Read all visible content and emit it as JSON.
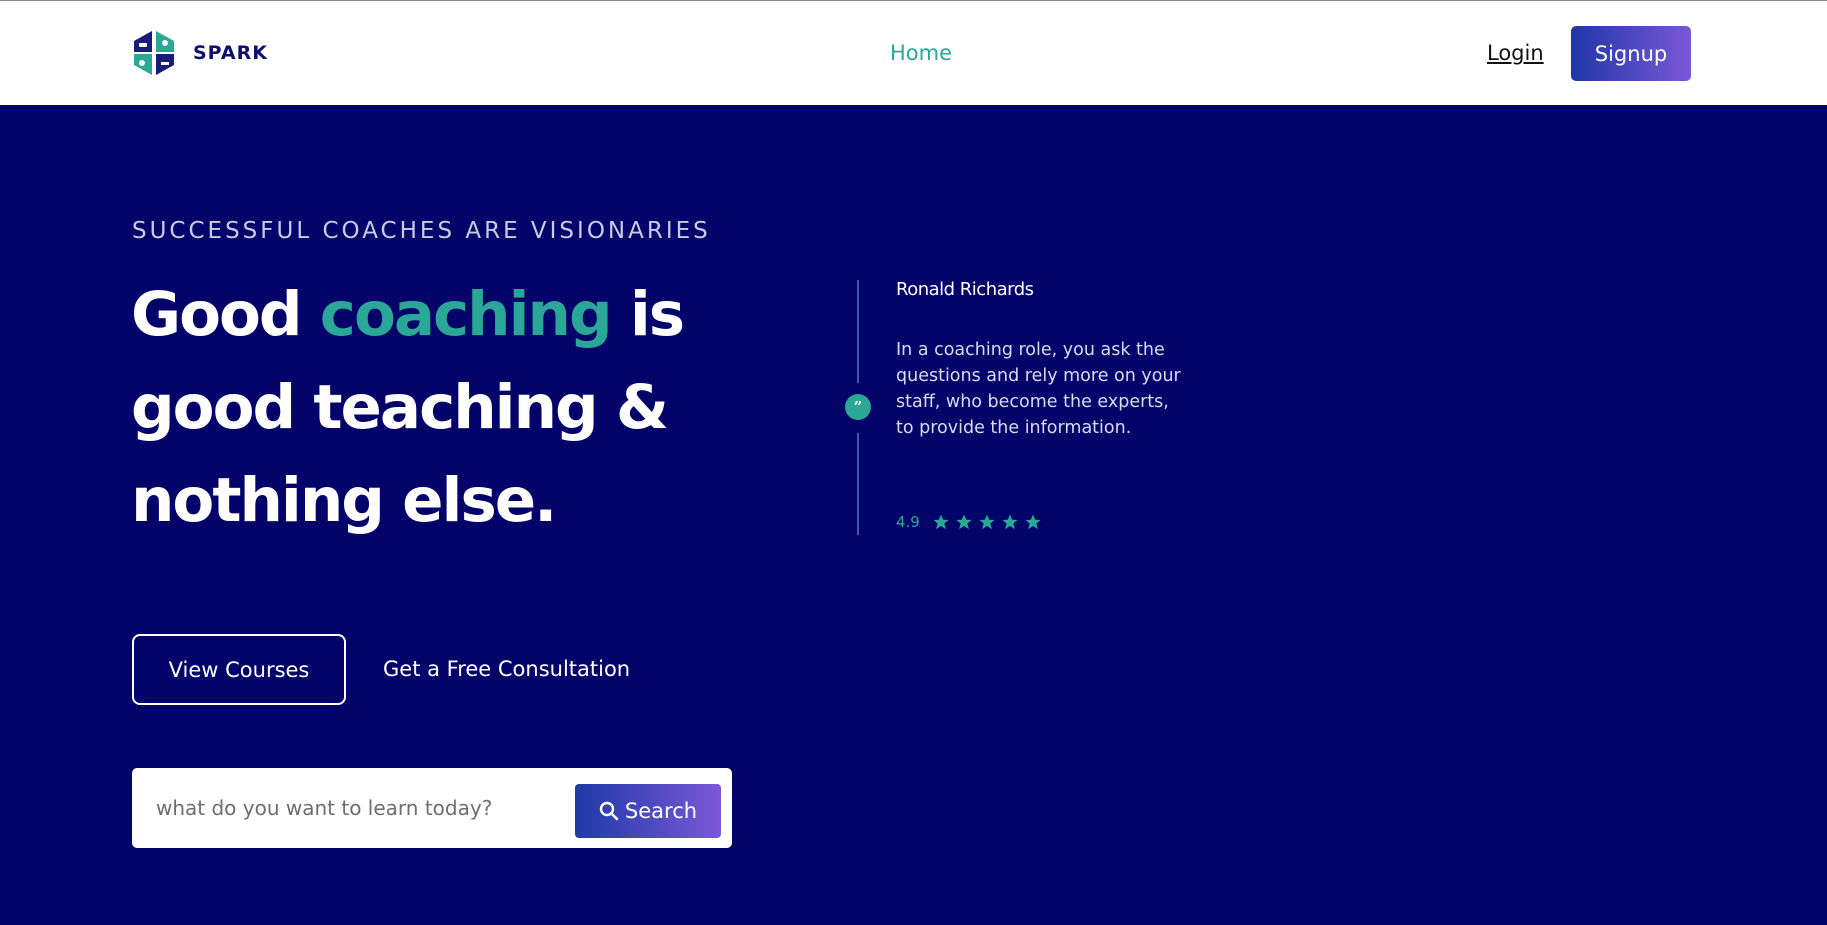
{
  "nav": {
    "brand": "SPARK",
    "home": "Home",
    "login": "Login",
    "signup": "Signup"
  },
  "hero": {
    "eyebrow": "SUCCESSFUL COACHES ARE VISIONARIES",
    "headline_part1": "Good ",
    "headline_accent": "coaching",
    "headline_part2": " is good teaching & nothing else.",
    "view_courses": "View Courses",
    "consultation": "Get a Free Consultation"
  },
  "search": {
    "placeholder": "what do you want to learn today?",
    "button": "Search"
  },
  "testimonial": {
    "name": "Ronald Richards",
    "quote": "In a coaching role, you ask the questions and rely more on your staff, who become the experts, to provide the information.",
    "rating": "4.9",
    "stars": 5
  },
  "colors": {
    "background": "#03036a",
    "accent": "#2aa796",
    "button_gradient_start": "#1e3aa6",
    "button_gradient_end": "#7b58d8"
  }
}
